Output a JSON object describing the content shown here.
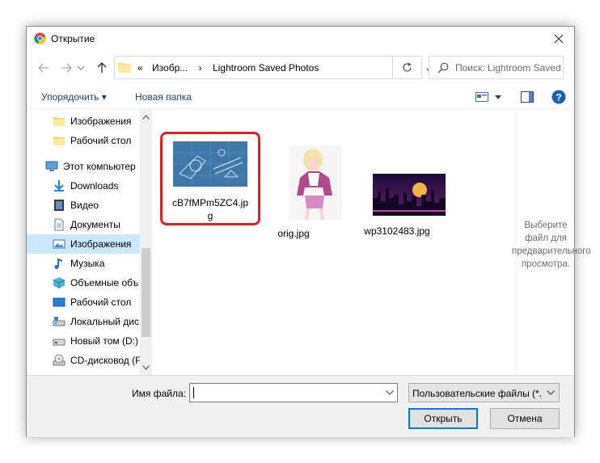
{
  "window": {
    "title": "Открытие"
  },
  "address": {
    "crumbs": [
      "«",
      "Изобр...",
      "›",
      "Lightroom Saved Photos"
    ],
    "search_placeholder": "Поиск: Lightroom Saved Ph..."
  },
  "toolbar": {
    "organize_label": "Упорядочить ▾",
    "new_folder_label": "Новая папка"
  },
  "sidebar": {
    "items": [
      {
        "label": "Изображения",
        "icon": "folder-icon"
      },
      {
        "label": "Рабочий стол",
        "icon": "folder-icon"
      },
      {
        "label": "Этот компьютер",
        "icon": "computer-icon"
      },
      {
        "label": "Downloads",
        "icon": "download-icon"
      },
      {
        "label": "Видео",
        "icon": "video-icon"
      },
      {
        "label": "Документы",
        "icon": "document-icon"
      },
      {
        "label": "Изображения",
        "icon": "pictures-icon",
        "selected": true
      },
      {
        "label": "Музыка",
        "icon": "music-icon"
      },
      {
        "label": "Объемные объ",
        "icon": "3d-objects-icon"
      },
      {
        "label": "Рабочий стол",
        "icon": "desktop-icon"
      },
      {
        "label": "Локальный дис",
        "icon": "drive-icon"
      },
      {
        "label": "Новый том (D:)",
        "icon": "drive-icon"
      },
      {
        "label": "CD-дисковод (F",
        "icon": "cd-drive-icon"
      }
    ]
  },
  "files": [
    {
      "name": "cB7fMPm5ZC4.jpg",
      "highlighted": true
    },
    {
      "name": "orig.jpg"
    },
    {
      "name": "wp3102483.jpg"
    }
  ],
  "preview": {
    "text": "Выберите файл для предварительного просмотра."
  },
  "bottom": {
    "filename_label": "Имя файла:",
    "filename_value": "",
    "filetype_value": "Пользовательские файлы (*.jf",
    "open_label": "Открыть",
    "cancel_label": "Отмена"
  },
  "colors": {
    "accent": "#0078d7",
    "selection": "#cce8ff",
    "highlight": "#e02020",
    "link": "#1e3e78"
  }
}
